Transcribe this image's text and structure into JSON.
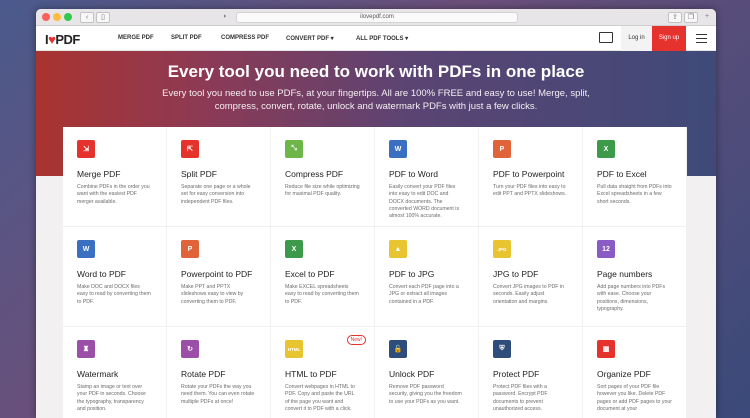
{
  "browser": {
    "url": "ilovepdf.com"
  },
  "nav": {
    "logo_text": "I",
    "logo_text2": "PDF",
    "links": [
      "MERGE PDF",
      "SPLIT PDF",
      "COMPRESS PDF",
      "CONVERT PDF ▾",
      "ALL PDF TOOLS ▾"
    ],
    "login": "Log in",
    "signup": "Sign up"
  },
  "hero": {
    "title": "Every tool you need to work with PDFs in one place",
    "subtitle": "Every tool you need to use PDFs, at your fingertips. All are 100% FREE and easy to use! Merge, split, compress, convert, rotate, unlock and watermark PDFs with just a few clicks."
  },
  "tools": [
    {
      "title": "Merge PDF",
      "desc": "Combine PDFs in the order you want with the easiest PDF merger available.",
      "color": "#e5322d",
      "glyph": "⇲"
    },
    {
      "title": "Split PDF",
      "desc": "Separate one page or a whole set for easy conversion into independent PDF files.",
      "color": "#e5322d",
      "glyph": "⇱"
    },
    {
      "title": "Compress PDF",
      "desc": "Reduce file size while optimizing for maximal PDF quality.",
      "color": "#6fb64a",
      "glyph": "⤡"
    },
    {
      "title": "PDF to Word",
      "desc": "Easily convert your PDF files into easy to edit DOC and DOCX documents. The converted WORD document is almost 100% accurate.",
      "color": "#3b6fc2",
      "glyph": "W"
    },
    {
      "title": "PDF to Powerpoint",
      "desc": "Turn your PDF files into easy to edit PPT and PPTX slideshows.",
      "color": "#e0633a",
      "glyph": "P"
    },
    {
      "title": "PDF to Excel",
      "desc": "Pull data straight from PDFs into Excel spreadsheets in a few short seconds.",
      "color": "#3d9a4a",
      "glyph": "X"
    },
    {
      "title": "Word to PDF",
      "desc": "Make DOC and DOCX files easy to read by converting them to PDF.",
      "color": "#3b6fc2",
      "glyph": "W"
    },
    {
      "title": "Powerpoint to PDF",
      "desc": "Make PPT and PPTX slideshows easy to view by converting them to PDF.",
      "color": "#e0633a",
      "glyph": "P"
    },
    {
      "title": "Excel to PDF",
      "desc": "Make EXCEL spreadsheets easy to read by converting them to PDF.",
      "color": "#3d9a4a",
      "glyph": "X"
    },
    {
      "title": "PDF to JPG",
      "desc": "Convert each PDF page into a JPG or extract all images contained in a PDF.",
      "color": "#e8c430",
      "glyph": "▲"
    },
    {
      "title": "JPG to PDF",
      "desc": "Convert JPG images to PDF in seconds. Easily adjust orientation and margins.",
      "color": "#e8c430",
      "glyph": "JPG"
    },
    {
      "title": "Page numbers",
      "desc": "Add page numbers into PDFs with ease. Choose your positions, dimensions, typography.",
      "color": "#8a5bc4",
      "glyph": "12"
    },
    {
      "title": "Watermark",
      "desc": "Stamp an image or text over your PDF in seconds. Choose the typography, transparency and position.",
      "color": "#9b4fa8",
      "glyph": "♜"
    },
    {
      "title": "Rotate PDF",
      "desc": "Rotate your PDFs the way you need them. You can even rotate multiple PDFs at once!",
      "color": "#9b4fa8",
      "glyph": "↻"
    },
    {
      "title": "HTML to PDF",
      "desc": "Convert webpages in HTML to PDF. Copy and paste the URL of the page you want and convert it to PDF with a click.",
      "color": "#e8c430",
      "glyph": "HTML",
      "badge": "New!"
    },
    {
      "title": "Unlock PDF",
      "desc": "Remove PDF password security, giving you the freedom to use your PDFs as you want.",
      "color": "#2f4d7a",
      "glyph": "🔓"
    },
    {
      "title": "Protect PDF",
      "desc": "Protect PDF files with a password. Encrypt PDF documents to prevent unauthorized access.",
      "color": "#2f4d7a",
      "glyph": "⛨"
    },
    {
      "title": "Organize PDF",
      "desc": "Sort pages of your PDF file however you like. Delete PDF pages or add PDF pages to your document at your",
      "color": "#e5322d",
      "glyph": "▦"
    }
  ]
}
